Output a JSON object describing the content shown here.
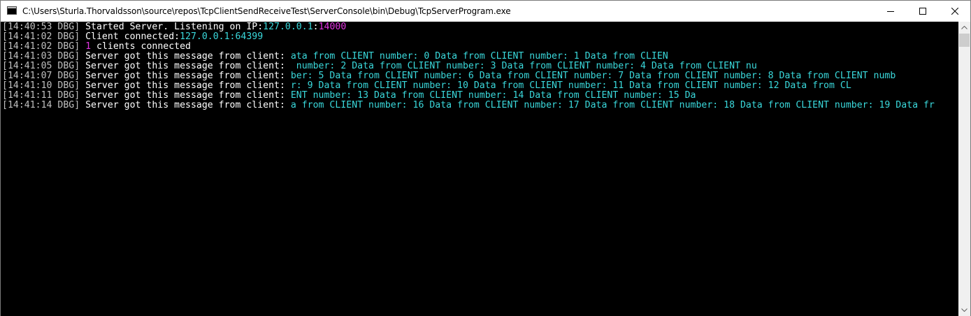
{
  "window": {
    "title": "C:\\Users\\Sturla.Thorvaldsson\\source\\repos\\TcpClientSendReceiveTest\\ServerConsole\\bin\\Debug\\TcpServerProgram.exe",
    "controls": {
      "minimize_icon": "minimize-icon",
      "maximize_icon": "maximize-icon",
      "close_icon": "close-icon"
    }
  },
  "colors": {
    "console_bg": "#000000",
    "timestamp": "#c0c0c0",
    "text": "#ffffff",
    "highlight_cyan": "#3ad9dc",
    "highlight_magenta": "#e235e2"
  },
  "log": [
    {
      "ts": "[14:40:53 DBG]",
      "parts": [
        {
          "text": " Started Server. Listening on IP:",
          "color": "white"
        },
        {
          "text": "127.0.0.1",
          "color": "cyan"
        },
        {
          "text": ":",
          "color": "white"
        },
        {
          "text": "14000",
          "color": "magenta"
        }
      ]
    },
    {
      "ts": "[14:41:02 DBG]",
      "parts": [
        {
          "text": " Client connected:",
          "color": "white"
        },
        {
          "text": "127.0.0.1:64399",
          "color": "cyan"
        }
      ]
    },
    {
      "ts": "[14:41:02 DBG]",
      "parts": [
        {
          "text": " ",
          "color": "white"
        },
        {
          "text": "1",
          "color": "magenta"
        },
        {
          "text": " clients connected",
          "color": "white"
        }
      ]
    },
    {
      "ts": "[14:41:03 DBG]",
      "parts": [
        {
          "text": " Server got this message from client: ",
          "color": "white"
        },
        {
          "text": "ata from CLIENT number: 0 Data from CLIENT number: 1 Data from CLIEN",
          "color": "cyan"
        }
      ]
    },
    {
      "ts": "[14:41:05 DBG]",
      "parts": [
        {
          "text": " Server got this message from client: ",
          "color": "white"
        },
        {
          "text": " number: 2 Data from CLIENT number: 3 Data from CLIENT number: 4 Data from CLIENT nu",
          "color": "cyan"
        }
      ]
    },
    {
      "ts": "[14:41:07 DBG]",
      "parts": [
        {
          "text": " Server got this message from client: ",
          "color": "white"
        },
        {
          "text": "ber: 5 Data from CLIENT number: 6 Data from CLIENT number: 7 Data from CLIENT number: 8 Data from CLIENT numb",
          "color": "cyan"
        }
      ]
    },
    {
      "ts": "[14:41:10 DBG]",
      "parts": [
        {
          "text": " Server got this message from client: ",
          "color": "white"
        },
        {
          "text": "r: 9 Data from CLIENT number: 10 Data from CLIENT number: 11 Data from CLIENT number: 12 Data from CL",
          "color": "cyan"
        }
      ]
    },
    {
      "ts": "[14:41:11 DBG]",
      "parts": [
        {
          "text": " Server got this message from client: ",
          "color": "white"
        },
        {
          "text": "ENT number: 13 Data from CLIENT number: 14 Data from CLIENT number: 15 Da",
          "color": "cyan"
        }
      ]
    },
    {
      "ts": "[14:41:14 DBG]",
      "parts": [
        {
          "text": " Server got this message from client: ",
          "color": "white"
        },
        {
          "text": "a from CLIENT number: 16 Data from CLIENT number: 17 Data from CLIENT number: 18 Data from CLIENT number: 19 Data fr",
          "color": "cyan"
        }
      ]
    }
  ]
}
